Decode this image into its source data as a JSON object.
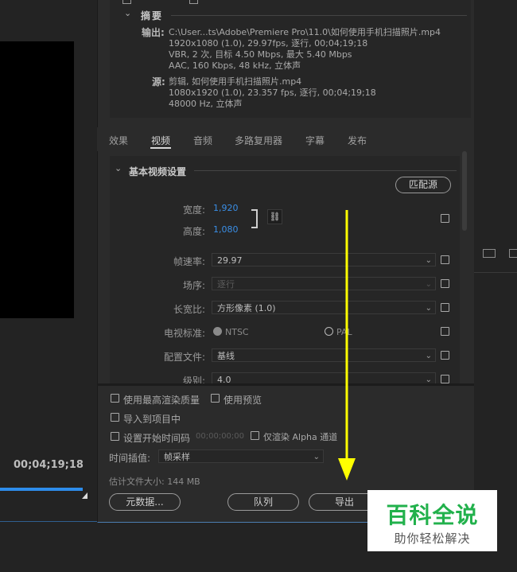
{
  "summary": {
    "title": "摘要",
    "output_label": "输出:",
    "output_lines": [
      "C:\\User...ts\\Adobe\\Premiere Pro\\11.0\\如何使用手机扫描照片.mp4",
      "1920x1080 (1.0), 29.97fps, 逐行, 00;04;19;18",
      "VBR, 2 次, 目标 4.50 Mbps, 最大 5.40 Mbps",
      "AAC, 160 Kbps, 48 kHz, 立体声"
    ],
    "source_label": "源:",
    "source_lines": [
      "剪辑, 如何使用手机扫描照片.mp4",
      "1080x1920 (1.0), 23.357 fps, 逐行, 00;04;19;18",
      "48000 Hz, 立体声"
    ]
  },
  "tabs": [
    "效果",
    "视频",
    "音频",
    "多路复用器",
    "字幕",
    "发布"
  ],
  "active_tab": "视频",
  "video": {
    "section_title": "基本视频设置",
    "match_source": "匹配源",
    "width_label": "宽度:",
    "width_value": "1,920",
    "height_label": "高度:",
    "height_value": "1,080",
    "frame_rate_label": "帧速率:",
    "frame_rate_value": "29.97",
    "field_order_label": "场序:",
    "field_order_value": "逐行",
    "aspect_label": "长宽比:",
    "aspect_value": "方形像素 (1.0)",
    "tv_standard_label": "电视标准:",
    "ntsc": "NTSC",
    "pal": "PAL",
    "profile_label": "配置文件:",
    "profile_value": "基线",
    "level_label": "级别:",
    "level_value": "4.0"
  },
  "options": {
    "max_render_quality": "使用最高渲染质量",
    "use_previews": "使用预览",
    "import_into_project": "导入到项目中",
    "set_start_timecode": "设置开始时间码",
    "start_timecode_value": "00;00;00;00",
    "render_alpha_only": "仅渲染 Alpha 通道",
    "time_interpolation_label": "时间插值:",
    "time_interpolation_value": "帧采样",
    "estimated_size": "估计文件大小: 144 MB"
  },
  "buttons": {
    "metadata": "元数据...",
    "queue": "队列",
    "export": "导出"
  },
  "left_panel": {
    "timecode": "00;04;19;18"
  },
  "watermark": {
    "title": "百科全说",
    "subtitle": "助你轻松解决"
  },
  "colors": {
    "accent_blue": "#3a8ee6",
    "arrow_yellow": "#ffff00",
    "watermark_green": "#22b14c"
  }
}
